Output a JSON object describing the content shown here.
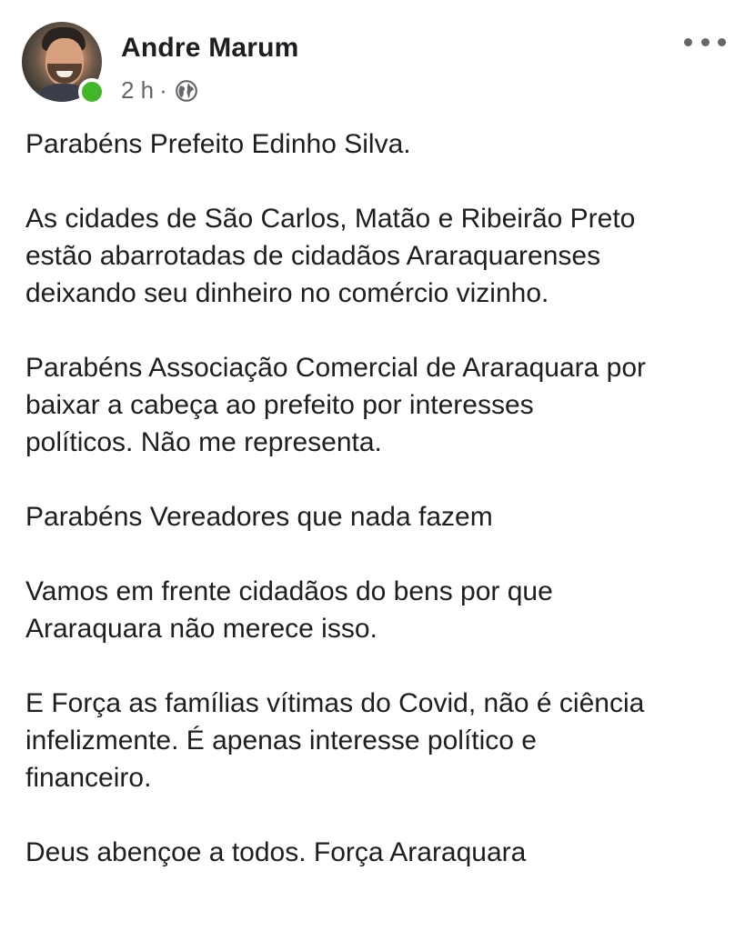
{
  "post": {
    "author": "Andre Marum",
    "time": "2 h",
    "separator": "·",
    "privacy_icon": "globe-icon",
    "more_icon": "more-horizontal-icon",
    "status_color": "#42b72a",
    "paragraphs": [
      "Parabéns Prefeito Edinho Silva.",
      "As cidades de São Carlos, Matão e Ribeirão Preto\nestão abarrotadas de cidadãos Araraquarenses\ndeixando seu dinheiro no comércio vizinho.",
      "Parabéns Associação Comercial de Araraquara por\nbaixar a cabeça ao prefeito por interesses\npolíticos. Não me representa.",
      "Parabéns Vereadores que nada fazem",
      "Vamos em frente cidadãos do bens por que\nAraraquara não merece isso.",
      "E Força as famílias vítimas do Covid, não é ciência\ninfelizmente. É apenas interesse político e\nfinanceiro.",
      "Deus abençoe a todos. Força Araraquara"
    ]
  }
}
